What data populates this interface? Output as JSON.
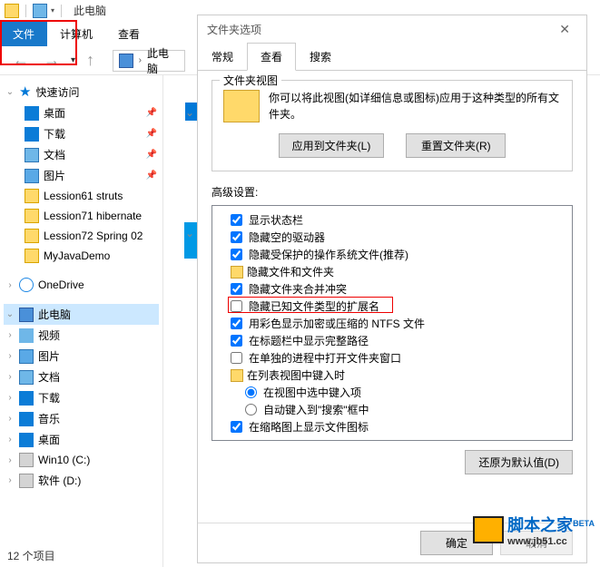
{
  "explorer": {
    "title": "此电脑",
    "ribbon": {
      "file": "文件",
      "computer": "计算机",
      "view": "查看"
    },
    "path": "此电脑",
    "status": "12 个项目"
  },
  "sidebar": {
    "quick": "快速访问",
    "desktop": "桌面",
    "downloads": "下载",
    "documents": "文档",
    "pictures": "图片",
    "f1": "Lession61 struts",
    "f2": "Lession71 hibernate",
    "f3": "Lession72 Spring 02",
    "f4": "MyJavaDemo",
    "onedrive": "OneDrive",
    "thispc": "此电脑",
    "videos": "视频",
    "pictures2": "图片",
    "documents2": "文档",
    "downloads2": "下载",
    "music": "音乐",
    "desktop2": "桌面",
    "drivec": "Win10 (C:)",
    "drived": "软件 (D:)"
  },
  "dialog": {
    "title": "文件夹选项",
    "tabs": {
      "general": "常规",
      "view": "查看",
      "search": "搜索"
    },
    "group": {
      "title": "文件夹视图",
      "desc": "你可以将此视图(如详细信息或图标)应用于这种类型的所有文件夹。",
      "apply": "应用到文件夹(L)",
      "reset": "重置文件夹(R)"
    },
    "advanced_label": "高级设置:",
    "opts": {
      "o1": "显示状态栏",
      "o2": "隐藏空的驱动器",
      "o3": "隐藏受保护的操作系统文件(推荐)",
      "o4": "隐藏文件和文件夹",
      "o5": "隐藏文件夹合并冲突",
      "o6": "隐藏已知文件类型的扩展名",
      "o7": "用彩色显示加密或压缩的 NTFS 文件",
      "o8": "在标题栏中显示完整路径",
      "o9": "在单独的进程中打开文件夹窗口",
      "o10": "在列表视图中键入时",
      "o10a": "在视图中选中键入项",
      "o10b": "自动键入到\"搜索\"框中",
      "o11": "在缩略图上显示文件图标"
    },
    "restore": "还原为默认值(D)",
    "ok": "确定",
    "cancel": "取消"
  },
  "watermark": {
    "main": "脚本之家",
    "sub": "www.jb51.cc",
    "beta": "BETA"
  }
}
